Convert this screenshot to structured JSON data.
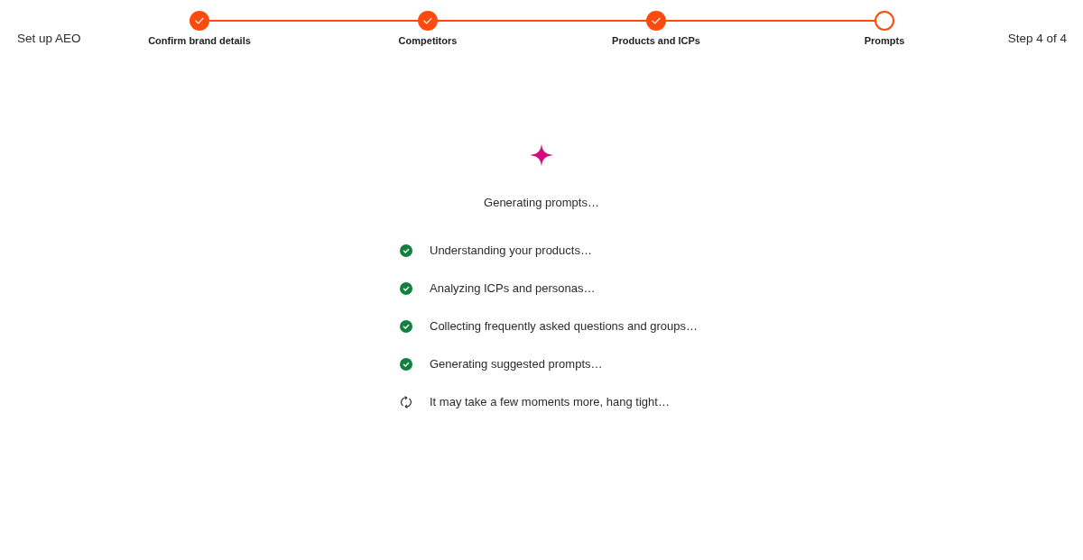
{
  "title": "Set up AEO",
  "steps": [
    {
      "label": "Confirm brand details",
      "completed": true
    },
    {
      "label": "Competitors",
      "completed": true
    },
    {
      "label": "Products and ICPs",
      "completed": true
    },
    {
      "label": "Prompts",
      "completed": false
    }
  ],
  "step_counter": "Step 4 of 4",
  "progress": {
    "heading": "Generating prompts…",
    "tasks": [
      {
        "label": "Understanding your products…",
        "done": true
      },
      {
        "label": "Analyzing ICPs and personas…",
        "done": true
      },
      {
        "label": "Collecting frequently asked questions and groups…",
        "done": true
      },
      {
        "label": "Generating suggested prompts…",
        "done": true
      },
      {
        "label": "It may take a few moments more, hang tight…",
        "done": false
      }
    ]
  }
}
